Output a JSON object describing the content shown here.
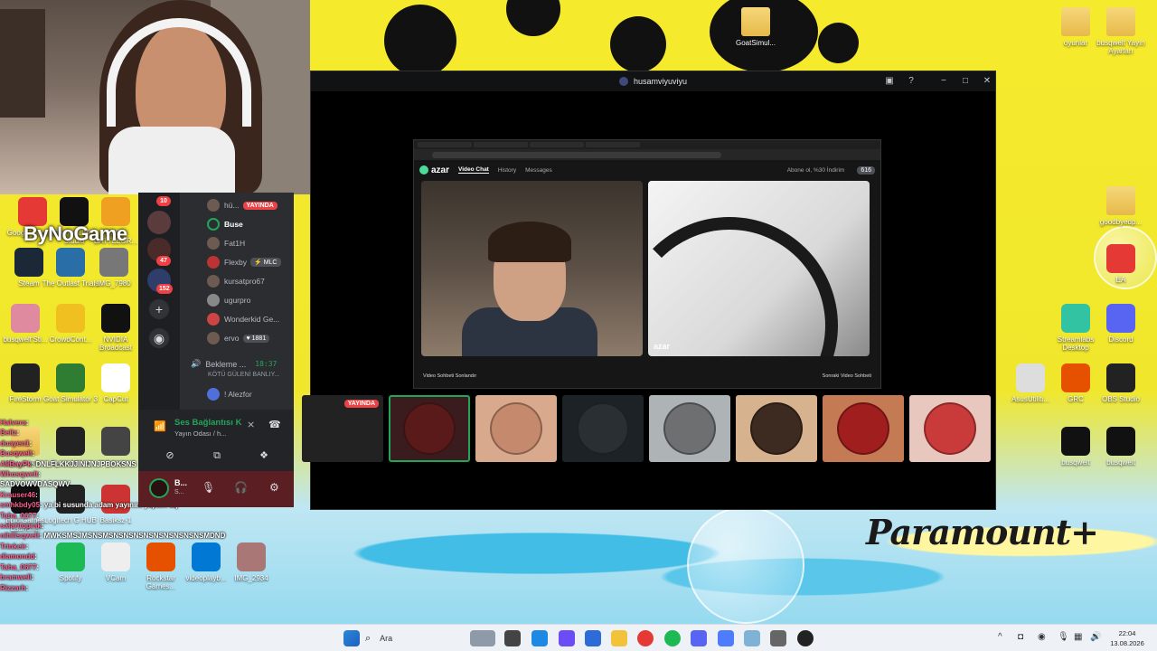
{
  "window": {
    "title": "husamviyuviyu",
    "streams_live_tag": "YAYINDA"
  },
  "desktop": {
    "overlay_text": "ByNoGame",
    "watermark": "Paramount+",
    "icons_left": [
      {
        "label": "Google Chrome",
        "icon": "chrome-icon"
      },
      {
        "label": "TikTok LIVE Studio",
        "icon": "tiktok-icon"
      },
      {
        "label": "PUBG BATTLEGR...",
        "icon": "pubg-icon"
      },
      {
        "label": "Steam",
        "icon": "steam-icon"
      },
      {
        "label": "The Outlast Trials",
        "icon": "outlast-icon"
      },
      {
        "label": "IMG_7980",
        "icon": "image-icon"
      },
      {
        "label": "busqwelt'Sti...",
        "icon": "avatar-icon"
      },
      {
        "label": "CrowdCont...",
        "icon": "crowdcontrol-icon"
      },
      {
        "label": "NVIDIA Broadcast",
        "icon": "nvidia-icon"
      },
      {
        "label": "FireStorm",
        "icon": "firestorm-icon"
      },
      {
        "label": "Goat Simulator 3",
        "icon": "goat-icon"
      },
      {
        "label": "CapCut",
        "icon": "capcut-icon"
      },
      {
        "label": "Busqwelt's...",
        "icon": "folder-icon"
      },
      {
        "label": "Speed Dates",
        "icon": "unity-icon"
      },
      {
        "label": "bucur",
        "icon": "image-icon"
      },
      {
        "label": "Epic Games Launcher",
        "icon": "epic-icon"
      },
      {
        "label": "Logitech G HUB",
        "icon": "logitech-icon"
      },
      {
        "label": "Basiksz-1",
        "icon": "image-icon"
      },
      {
        "label": "Rockstar Games...",
        "icon": "rockstar-icon"
      },
      {
        "label": "videoplayb...",
        "icon": "video-icon"
      },
      {
        "label": "IMG_2934",
        "icon": "image-icon"
      },
      {
        "label": "Spotify",
        "icon": "spotify-icon"
      },
      {
        "label": "VCam",
        "icon": "vcam-icon"
      }
    ],
    "icons_right": [
      {
        "label": "GoatSimul...",
        "icon": "folder-icon"
      },
      {
        "label": "oyunlar",
        "icon": "folder-icon"
      },
      {
        "label": "busqwelt Yayın Ayarları",
        "icon": "folder-icon"
      },
      {
        "label": "goodbyedp...",
        "icon": "folder-icon"
      },
      {
        "label": "EA",
        "icon": "ea-icon"
      },
      {
        "label": "Streamlabs Desktop",
        "icon": "streamlabs-icon"
      },
      {
        "label": "Discord",
        "icon": "discord-icon"
      },
      {
        "label": "AsusUtiliti...",
        "icon": "asus-icon"
      },
      {
        "label": "GRC",
        "icon": "grc-icon"
      },
      {
        "label": "OBS Studio",
        "icon": "obs-icon"
      },
      {
        "label": "busqwelt",
        "icon": "video-icon"
      },
      {
        "label": "busqwelt",
        "icon": "video-icon"
      }
    ]
  },
  "chat": [
    {
      "user": "Halvera",
      "msg": ""
    },
    {
      "user": "Beliz",
      "msg": ""
    },
    {
      "user": "duayen1",
      "msg": ""
    },
    {
      "user": "Busqwelt",
      "msg": ""
    },
    {
      "user": "AliBayPk",
      "msg": "DNLFLKKJJINIJNJPBOKSNS"
    },
    {
      "user": "Whosqwelt",
      "msg": ""
    },
    {
      "user": "",
      "msg": "SADVOWVDASQWV"
    },
    {
      "user": "Krauser46",
      "msg": ""
    },
    {
      "user": "smhkbdy05",
      "msg": "ya bi susunda adam yayınını yapsın aq"
    },
    {
      "user": "Taha_0677",
      "msg": ""
    },
    {
      "user": "safaritoprak",
      "msg": ""
    },
    {
      "user": "nihilisqwelt",
      "msg": "MWKSMSJMSNSMSNSNSNSNSNSNSNSNSNSMDND"
    },
    {
      "user": "Trinkeir",
      "msg": ""
    },
    {
      "user": "diamondd",
      "msg": ""
    },
    {
      "user": "Taha_0677",
      "msg": ""
    },
    {
      "user": "bramwell",
      "msg": ""
    },
    {
      "user": "Rizzarh",
      "msg": ""
    }
  ],
  "discord": {
    "server_badges": [
      "10",
      "47",
      "152"
    ],
    "members": [
      {
        "name": "hü...",
        "live": "YAYINDA"
      },
      {
        "name": "Buse",
        "active": true
      },
      {
        "name": "Fat1H"
      },
      {
        "name": "Flexby",
        "chip": "⚡ MLC"
      },
      {
        "name": "kursatpro67"
      },
      {
        "name": "ugurpro"
      },
      {
        "name": "Wonderkid Ge..."
      },
      {
        "name": "ervo",
        "chip": "♥ 1881"
      }
    ],
    "channel": {
      "name": "Bekleme ...",
      "time": "18:37",
      "subtitle": "KÖTÜ GÜLENİ BANLIY...",
      "user": "! Alezfor"
    },
    "voice": {
      "title": "Ses Bağlantısı K",
      "subtitle": "Yayın Odası / h..."
    },
    "user": {
      "name": "B...",
      "status": "S..."
    }
  },
  "azar": {
    "logo": "azar",
    "nav": [
      "Video Chat",
      "History",
      "Messages"
    ],
    "promo": "Abone ol, %30 İndirim",
    "gems": "616",
    "footer_left": "Video Sohbeti Sonlandır",
    "footer_right": "Sonraki Video Sohbeti",
    "watermark": "azar"
  },
  "taskbar": {
    "search_placeholder": "Ara",
    "time": "22:04",
    "date": "13.08.2026"
  },
  "colors": {
    "discord_green": "#23a559",
    "live_red": "#ed4245",
    "wallpaper_yellow": "#f0e72c"
  }
}
